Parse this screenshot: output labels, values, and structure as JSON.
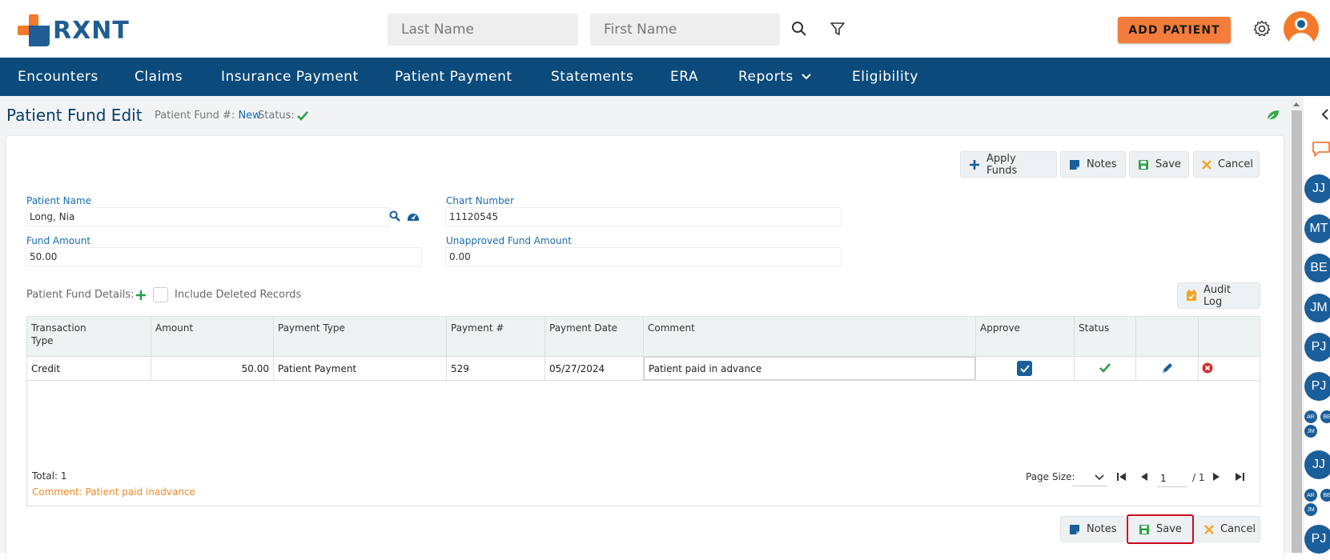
{
  "header": {
    "logo_text": "RXNT",
    "last_name_placeholder": "Last Name",
    "first_name_placeholder": "First Name",
    "add_patient_label": "ADD PATIENT"
  },
  "nav": {
    "items": [
      "Encounters",
      "Claims",
      "Insurance Payment",
      "Patient Payment",
      "Statements",
      "ERA",
      "Reports",
      "Eligibility"
    ]
  },
  "page": {
    "title": "Patient Fund Edit",
    "fund_no_label": "Patient Fund #:",
    "fund_no_value": "New",
    "status_label": "Status:"
  },
  "toolbar": {
    "apply_funds": "Apply Funds",
    "notes": "Notes",
    "save": "Save",
    "cancel": "Cancel"
  },
  "form": {
    "patient_name_label": "Patient Name",
    "patient_name_value": "Long, Nia",
    "chart_number_label": "Chart Number",
    "chart_number_value": "11120545",
    "fund_amount_label": "Fund Amount",
    "fund_amount_value": "50.00",
    "unapproved_label": "Unapproved Fund Amount",
    "unapproved_value": "0.00"
  },
  "details": {
    "label": "Patient Fund Details:",
    "include_deleted": "Include Deleted Records",
    "audit_log": "Audit Log"
  },
  "grid": {
    "columns": [
      "Transaction Type",
      "Amount",
      "Payment Type",
      "Payment #",
      "Payment Date",
      "Comment",
      "Approve",
      "Status"
    ],
    "col_tt_1": "Transaction",
    "col_tt_2": "Type",
    "rows": [
      {
        "transaction_type": "Credit",
        "amount": "50.00",
        "payment_type": "Patient Payment",
        "payment_no": "529",
        "payment_date": "05/27/2024",
        "comment": "Patient paid in advance",
        "approved": true
      }
    ],
    "total": "Total: 1",
    "comment_footer": "Comment: Patient paid inadvance",
    "page_size_label": "Page Size:",
    "page_current": "1",
    "page_total": "/ 1"
  },
  "bottom": {
    "notes": "Notes",
    "save": "Save",
    "cancel": "Cancel"
  },
  "sidebar": {
    "bubbles": [
      "JJ",
      "MT",
      "BE",
      "JM",
      "PJ",
      "PJ",
      "JJ",
      "PJ"
    ],
    "small_bubbles_1": [
      "AR",
      "BE",
      "JM"
    ],
    "small_bubbles_2": [
      "AR",
      "BE",
      "JM"
    ]
  },
  "colors": {
    "brand_blue": "#0b4a7a",
    "brand_orange": "#f47c3c",
    "link_blue": "#1a6bb0",
    "success_green": "#2e9e4a",
    "danger_red": "#d32f2f",
    "highlight_red": "#d0021b"
  }
}
